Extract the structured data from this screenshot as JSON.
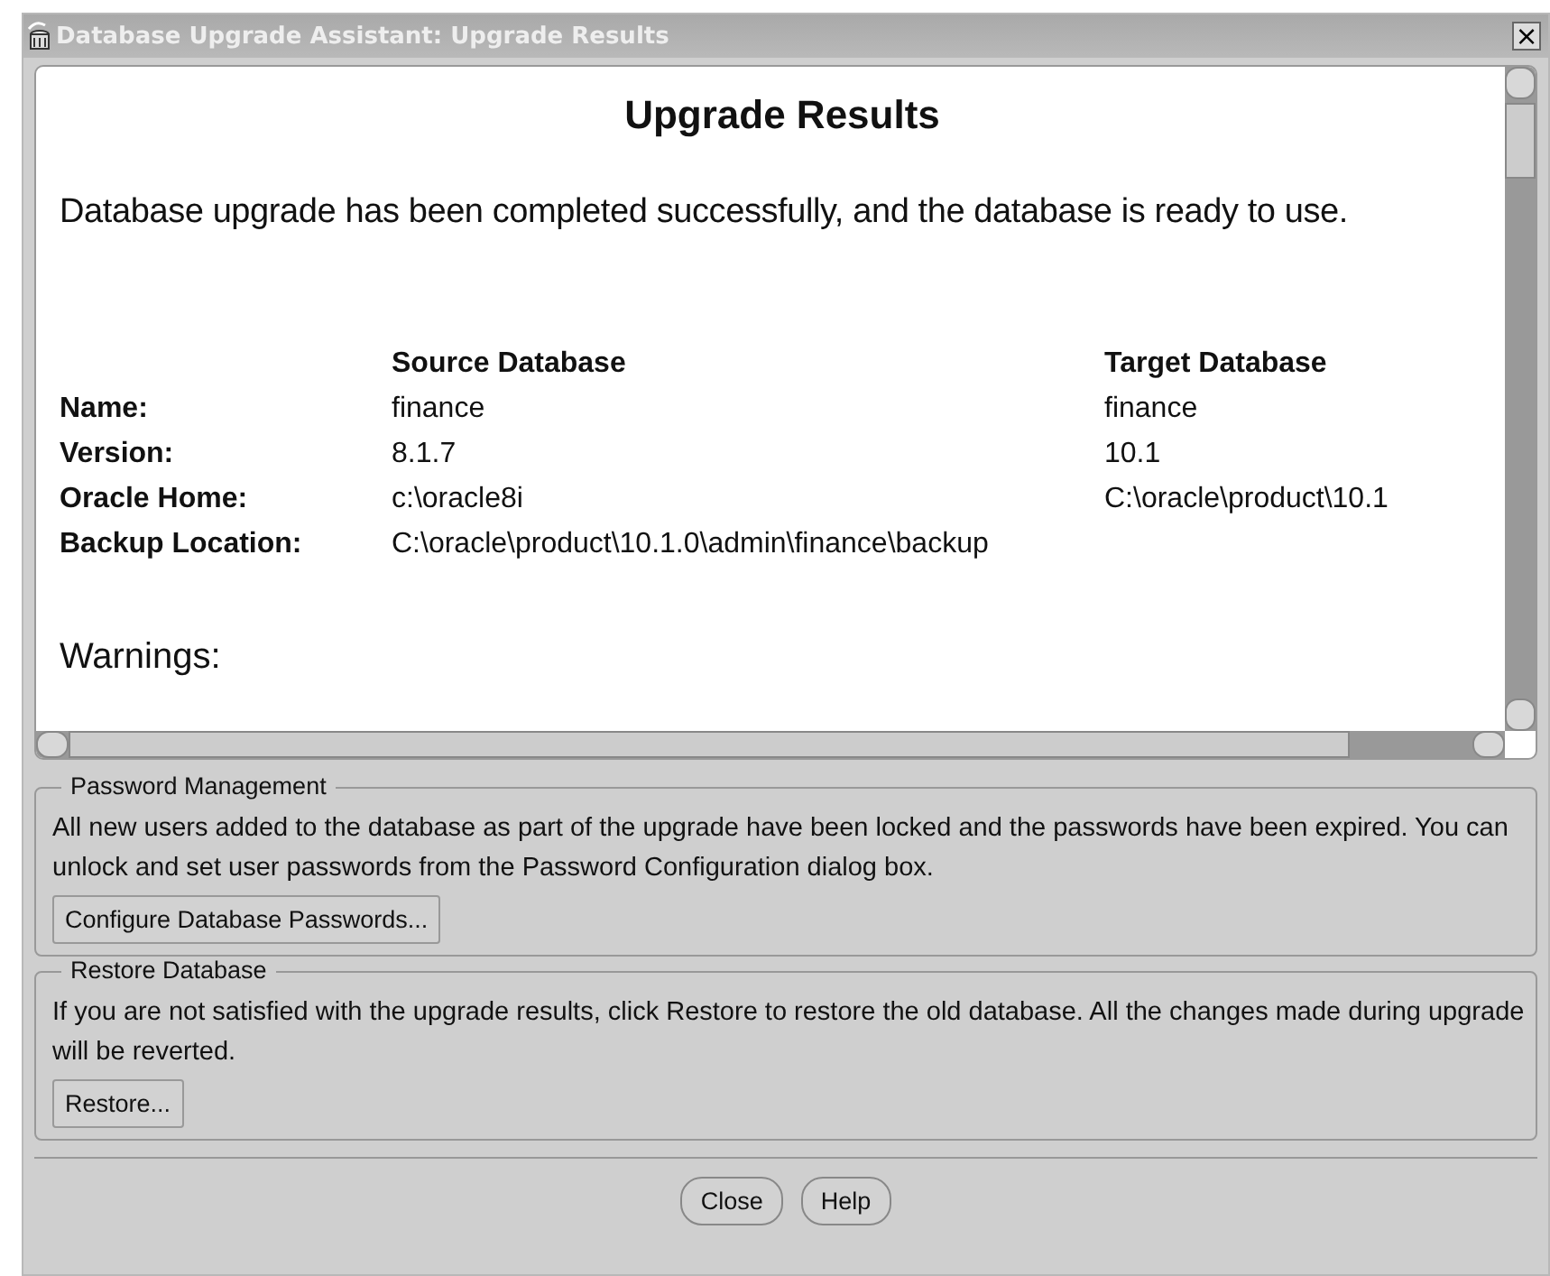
{
  "window": {
    "title": "Database Upgrade Assistant: Upgrade Results",
    "close_glyph": "×"
  },
  "results": {
    "heading": "Upgrade Results",
    "message": "Database upgrade has been completed successfully, and the database is ready to use.",
    "columns": [
      "Source Database",
      "Target Database"
    ],
    "rows": [
      {
        "label": "Name:",
        "source": "finance",
        "target": "finance"
      },
      {
        "label": "Version:",
        "source": "8.1.7",
        "target": "10.1"
      },
      {
        "label": "Oracle Home:",
        "source": "c:\\oracle8i",
        "target": "C:\\oracle\\product\\10.1"
      },
      {
        "label": "Backup Location:",
        "source": "C:\\oracle\\product\\10.1.0\\admin\\finance\\backup",
        "target": ""
      }
    ],
    "warnings_heading": "Warnings:"
  },
  "groups": [
    {
      "title": "Password Management",
      "text": "All new users added to the database as part of the upgrade have been locked and the passwords have been expired. You can unlock and set user passwords from the Password Configuration dialog box.",
      "button": "Configure Database Passwords..."
    },
    {
      "title": "Restore Database",
      "text": "If you are not satisfied with the upgrade results, click Restore to restore the old database. All the changes made during upgrade will be reverted.",
      "button": "Restore..."
    }
  ],
  "buttons": [
    "Close",
    "Help"
  ]
}
